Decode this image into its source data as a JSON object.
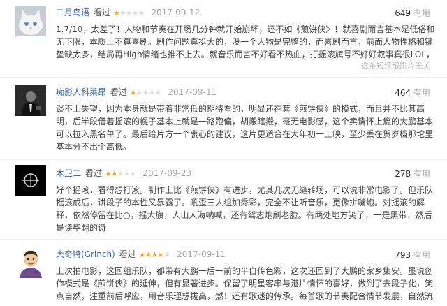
{
  "reviews": [
    {
      "author": "二月鸟语",
      "saw": "看过",
      "rating": 1,
      "date": "2017-09-12",
      "votes": "649",
      "vote_unit": "有用",
      "avatar": "white-cat-avatar",
      "body": "1.7/10，太差了！人物和节奏在开场几分钟就开始崩坏，还不如《煎饼侠》！就喜剧而言基本是低俗和无下限，本质上不算喜剧。剧作问题真挺大的，没一个人物是完整的，而喜剧而言，前面人物性格和铺垫缺太多，结局再High情绪也推不上去。就音乐而言不好看不热血，打摇滚旗号不好好叙事真很LOL，何况还没摸到摇滚内核！",
      "footer": "这条短评跟影片无关"
    },
    {
      "author": "痴影人科莱昂",
      "saw": "看过",
      "rating": 1,
      "date": "2017-09-11",
      "votes": "464",
      "vote_unit": "有用",
      "avatar": "godfather-avatar",
      "body": "谈不上失望，因为本身就是带着非常低的期待看的，明显还在套《煎饼侠》的模式，而且并不比其高明，后半段借着摇滚的幌子基本上就是一路跑偏，胡搬瞎搬，毫无电影感，这个卖情怀上瘾的大鹏基本可以拉入黑名单了。最后给片方一个衷心的建议，这片更适合在大年初一上映，至少丢在贺岁档那坨里基本分不出个高低。",
      "footer": ""
    },
    {
      "author": "木卫二",
      "saw": "看过",
      "rating": 2,
      "date": "2017-09-23",
      "votes": "278",
      "vote_unit": "有用",
      "avatar": "dark-logo-avatar",
      "body": "好个摇滚，看得想打滚。制作上比《煎饼侠》有进步，尤其几次无缝转场，可以说非常电影了。但乐队摇滚成后，讲段子的本性又暴露了。吼歪三人组加秀彩，完全不让听音乐，更像拼嘴炮。对摇滚的解释，依然停留在比○，摇大旗，人山人海呐喊，还有驾志炮刷老脸。有两处地方笑了，一是黑带，然后是读毕翻的诗",
      "footer": ""
    },
    {
      "author": "大奇特(Grinch)",
      "saw": "看过",
      "rating": 4,
      "date": "2017-09-11",
      "votes": "793",
      "vote_unit": "有用",
      "avatar": "cartoon-man-avatar",
      "body": "上次拍电影，这回组乐队，都带有大鹏一后一前的半自传色彩，这次还回到了大鹏的家乡集安。虽说创作模式是《煎饼侠》的延伸，但有显著进步。保留了明星客串与港片情怀的喜好，做到了去段子化，笑点自然，注重前后呼应，用音乐理想拔高，燃！还有歌迷的传承。每首歌的节奏配合情节发展，自然流畅。",
      "footer": ""
    }
  ]
}
